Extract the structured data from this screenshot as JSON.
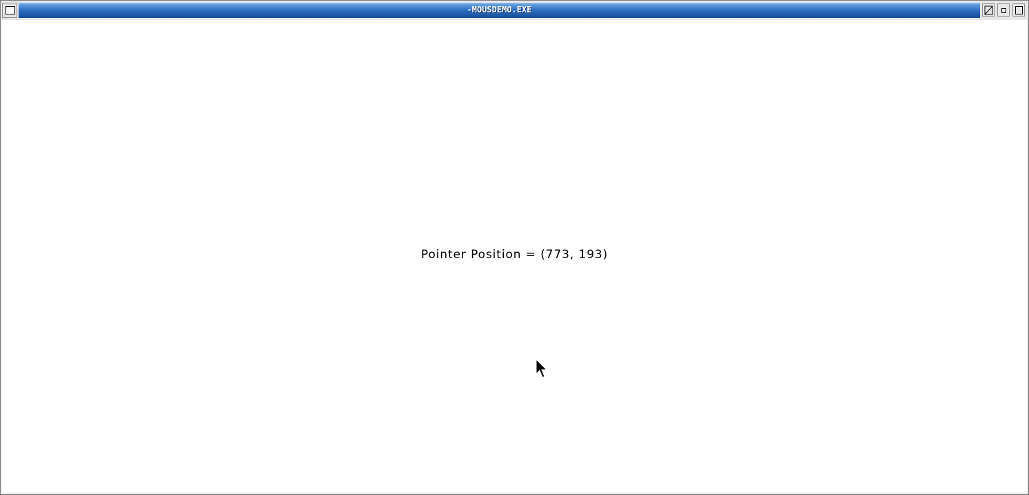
{
  "window": {
    "title": "-MOUSDEMO.EXE",
    "caption_color_top": "#6fa8e6",
    "caption_color_bottom": "#154b9a"
  },
  "controls": {
    "system_menu_icon": "window-menu-icon",
    "first_icon": "resize-icon",
    "second_icon": "minimize-icon",
    "third_icon": "maximize-icon"
  },
  "content": {
    "pointer_text": "Pointer Position = (773, 193)",
    "cursor_icon": "arrow-cursor-icon"
  }
}
